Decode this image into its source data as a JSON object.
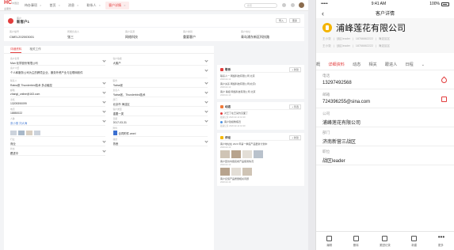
{
  "desktop": {
    "logo": "HC",
    "logo_sub": "中国企业服务",
    "tabs": [
      {
        "label": "待办事项"
      },
      {
        "label": "首页"
      },
      {
        "label": "消息"
      },
      {
        "label": "联系人"
      },
      {
        "label": "客户详情",
        "active": true
      }
    ],
    "search_placeholder": "搜索",
    "header": {
      "type": "客户",
      "name": "新客户1",
      "btn_import": "导入",
      "btn_more": "更多"
    },
    "summary": [
      {
        "k": "客户编号",
        "v": "CMEL202003001"
      },
      {
        "k": "所属负责人",
        "v": "张三"
      },
      {
        "k": "客户来源",
        "v": "网络科技"
      },
      {
        "k": "客户类别",
        "v": "重要客户"
      },
      {
        "k": "客户地址",
        "v": "青岛浦东新区科技路"
      }
    ],
    "left_tabs": [
      "详细资料",
      "相关工作"
    ],
    "fields": [
      {
        "k": "客户名称",
        "v": "Man 化学股份有限公司"
      },
      {
        "k": "客户等级",
        "v": "大客户"
      },
      {
        "k": "客户介绍",
        "v": "个人和服务公司为主的跨境企业，服务外贸产业与互联网软件",
        "full": true
      },
      {
        "k": "联系人",
        "v": "Ratna张   Thunderbird技术   多点触控"
      },
      {
        "k": "职务",
        "v": "Ratna张"
      },
      {
        "k": "邮箱",
        "v": "zhangl_online@163.com"
      },
      {
        "k": "负责人",
        "v": "Ratna张，Thunderbird技术"
      },
      {
        "k": "手机",
        "v": "13209390099"
      },
      {
        "k": "部门",
        "v": "北京市 海淀区"
      },
      {
        "k": "电话",
        "v": "18850022"
      },
      {
        "k": "客户类型",
        "v": "重要一类"
      },
      {
        "k": "人脉",
        "v": "张小丽  刘大海",
        "link": true
      },
      {
        "k": "日期",
        "v": "2017-03-31"
      },
      {
        "k": "附件",
        "v": "合同附件.word"
      },
      {
        "k": "行业",
        "v": "商业"
      },
      {
        "k": "描述",
        "v": "熟悉",
        "full": false
      },
      {
        "k": "状态",
        "v": "跟进中"
      }
    ],
    "right_cards": {
      "contacts": {
        "title": "联系",
        "add": "+ 新建",
        "rows": [
          {
            "t": "联系人一 网络科技有限公司 北京",
            "sub": "2020-02-12"
          },
          {
            "t": "客户关系 网络科技有限公司(北京)",
            "sub": "2020-02-12"
          },
          {
            "t": "客户 等级 网络科技有限公司 北京",
            "sub": "2020-02-13"
          }
        ]
      },
      "records": {
        "title": "动态",
        "add": "+ 筛选",
        "rows": [
          {
            "t": "对王丁在王某约见面了",
            "sub": "跟进记录 2020-02-12 10:20"
          },
          {
            "t": "客户建模教练员",
            "sub": "跟进记录 2020-02-12 10:20"
          }
        ]
      },
      "comments": {
        "title": "评论",
        "add": "+ 新建",
        "rows": [
          {
            "t": "客户地址在 2020 年第一季度产品更新计划中",
            "sub": "2020-02-12"
          },
          {
            "t": "客户回访内容完成产品使用情况",
            "sub": "2020-02-13"
          },
          {
            "t": "客户反馈产品质量相关问题",
            "sub": "2020-02-14"
          }
        ]
      }
    }
  },
  "mobile": {
    "time": "9:41 AM",
    "carrier": "•••••",
    "battery": "100%",
    "nav_title": "客户详情",
    "company": "浦峰莲花有限公司",
    "tags": [
      "王小张",
      "战区leader",
      "18766662222",
      "海淀区区",
      "王小张",
      "战区leader",
      "18766662222",
      "海淀区区"
    ],
    "tabs": [
      "概",
      "详细资料",
      "动态",
      "相关",
      "跟进人",
      "日程"
    ],
    "active_tab": "详细资料",
    "fields": [
      {
        "k": "电话",
        "v": "13297492568",
        "act": "phone"
      },
      {
        "k": "邮箱",
        "v": "724396255@sina.com",
        "act": "mail"
      },
      {
        "k": "公司",
        "v": "浦峰莲花有限公司"
      },
      {
        "k": "部门",
        "v": "济南新营三战区"
      },
      {
        "k": "职位",
        "v": "战区leader"
      }
    ],
    "bottom": [
      "编辑",
      "删除",
      "跟进记录",
      "新建",
      "更多"
    ]
  }
}
